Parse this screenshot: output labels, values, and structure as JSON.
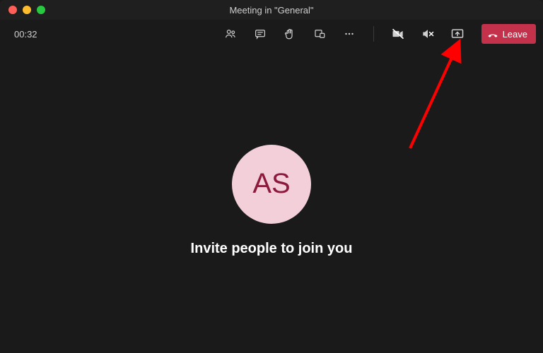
{
  "window": {
    "title": "Meeting in \"General\""
  },
  "toolbar": {
    "timer": "00:32",
    "leave_label": "Leave"
  },
  "participant": {
    "initials": "AS"
  },
  "main": {
    "invite_text": "Invite people to join you"
  },
  "icons": {
    "people": "people-icon",
    "chat": "chat-icon",
    "raise_hand": "raise-hand-icon",
    "breakout": "breakout-rooms-icon",
    "more": "more-actions-icon",
    "camera_off": "camera-off-icon",
    "mic_off": "speaker-off-icon",
    "share": "share-screen-icon",
    "hangup": "hangup-icon"
  },
  "colors": {
    "leave_bg": "#c4314b",
    "avatar_bg": "#f3cfda",
    "avatar_fg": "#8b1a3c"
  }
}
